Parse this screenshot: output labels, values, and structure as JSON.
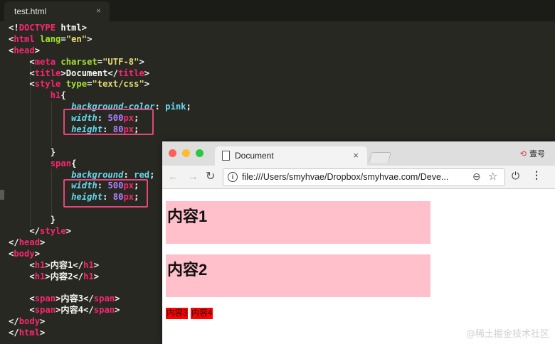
{
  "editor": {
    "tab_title": "test.html",
    "tab_close": "×",
    "code_lines": [
      [
        {
          "c": "pn",
          "t": "<!"
        },
        {
          "c": "tk",
          "t": "DOCTYPE"
        },
        {
          "c": "pn",
          "t": " html>"
        }
      ],
      [
        {
          "c": "pn",
          "t": "<"
        },
        {
          "c": "tk",
          "t": "html"
        },
        {
          "c": "at",
          "t": " lang"
        },
        {
          "c": "pn",
          "t": "="
        },
        {
          "c": "st",
          "t": "\"en\""
        },
        {
          "c": "pn",
          "t": ">"
        }
      ],
      [
        {
          "c": "pn",
          "t": "<"
        },
        {
          "c": "tk",
          "t": "head"
        },
        {
          "c": "pn",
          "t": ">"
        }
      ],
      [
        {
          "c": "pn",
          "t": "    <"
        },
        {
          "c": "tk",
          "t": "meta"
        },
        {
          "c": "at",
          "t": " charset"
        },
        {
          "c": "pn",
          "t": "="
        },
        {
          "c": "st",
          "t": "\"UTF-8\""
        },
        {
          "c": "pn",
          "t": ">"
        }
      ],
      [
        {
          "c": "pn",
          "t": "    <"
        },
        {
          "c": "tk",
          "t": "title"
        },
        {
          "c": "pn",
          "t": ">Document</"
        },
        {
          "c": "tk",
          "t": "title"
        },
        {
          "c": "pn",
          "t": ">"
        }
      ],
      [
        {
          "c": "pn",
          "t": "    <"
        },
        {
          "c": "tk",
          "t": "style"
        },
        {
          "c": "at",
          "t": " type"
        },
        {
          "c": "pn",
          "t": "="
        },
        {
          "c": "st",
          "t": "\"text/css\""
        },
        {
          "c": "pn",
          "t": ">"
        }
      ],
      [
        {
          "c": "pn",
          "t": "        "
        },
        {
          "c": "tk",
          "t": "h1"
        },
        {
          "c": "pn",
          "t": "{"
        }
      ],
      [
        {
          "c": "pn",
          "t": "            "
        },
        {
          "c": "pr",
          "t": "background-color"
        },
        {
          "c": "pn",
          "t": ": "
        },
        {
          "c": "kw",
          "t": "pink"
        },
        {
          "c": "pn",
          "t": ";"
        }
      ],
      [
        {
          "c": "pn",
          "t": "            "
        },
        {
          "c": "pr",
          "t": "width"
        },
        {
          "c": "pn",
          "t": ": "
        },
        {
          "c": "nm",
          "t": "500"
        },
        {
          "c": "un",
          "t": "px"
        },
        {
          "c": "pn",
          "t": ";"
        }
      ],
      [
        {
          "c": "pn",
          "t": "            "
        },
        {
          "c": "pr",
          "t": "height"
        },
        {
          "c": "pn",
          "t": ": "
        },
        {
          "c": "nm",
          "t": "80"
        },
        {
          "c": "un",
          "t": "px"
        },
        {
          "c": "pn",
          "t": ";"
        }
      ],
      [
        {
          "c": "pn",
          "t": ""
        }
      ],
      [
        {
          "c": "pn",
          "t": "        }"
        }
      ],
      [
        {
          "c": "pn",
          "t": "        "
        },
        {
          "c": "tk",
          "t": "span"
        },
        {
          "c": "pn",
          "t": "{"
        }
      ],
      [
        {
          "c": "pn",
          "t": "            "
        },
        {
          "c": "pr",
          "t": "background"
        },
        {
          "c": "pn",
          "t": ": "
        },
        {
          "c": "kw",
          "t": "red"
        },
        {
          "c": "pn",
          "t": ";"
        }
      ],
      [
        {
          "c": "pn",
          "t": "            "
        },
        {
          "c": "pr",
          "t": "width"
        },
        {
          "c": "pn",
          "t": ": "
        },
        {
          "c": "nm",
          "t": "500"
        },
        {
          "c": "un",
          "t": "px"
        },
        {
          "c": "pn",
          "t": ";"
        }
      ],
      [
        {
          "c": "pn",
          "t": "            "
        },
        {
          "c": "pr",
          "t": "height"
        },
        {
          "c": "pn",
          "t": ": "
        },
        {
          "c": "nm",
          "t": "80"
        },
        {
          "c": "un",
          "t": "px"
        },
        {
          "c": "pn",
          "t": ";"
        }
      ],
      [
        {
          "c": "pn",
          "t": ""
        }
      ],
      [
        {
          "c": "pn",
          "t": "        }"
        }
      ],
      [
        {
          "c": "pn",
          "t": "    </"
        },
        {
          "c": "tk",
          "t": "style"
        },
        {
          "c": "pn",
          "t": ">"
        }
      ],
      [
        {
          "c": "pn",
          "t": "</"
        },
        {
          "c": "tk",
          "t": "head"
        },
        {
          "c": "pn",
          "t": ">"
        }
      ],
      [
        {
          "c": "pn",
          "t": "<"
        },
        {
          "c": "tk",
          "t": "body"
        },
        {
          "c": "pn",
          "t": ">"
        }
      ],
      [
        {
          "c": "pn",
          "t": "    <"
        },
        {
          "c": "tk",
          "t": "h1"
        },
        {
          "c": "pn",
          "t": ">内容1</"
        },
        {
          "c": "tk",
          "t": "h1"
        },
        {
          "c": "pn",
          "t": ">"
        }
      ],
      [
        {
          "c": "pn",
          "t": "    <"
        },
        {
          "c": "tk",
          "t": "h1"
        },
        {
          "c": "pn",
          "t": ">内容2</"
        },
        {
          "c": "tk",
          "t": "h1"
        },
        {
          "c": "pn",
          "t": ">"
        }
      ],
      [
        {
          "c": "pn",
          "t": ""
        }
      ],
      [
        {
          "c": "pn",
          "t": "    <"
        },
        {
          "c": "tk",
          "t": "span"
        },
        {
          "c": "pn",
          "t": ">内容3</"
        },
        {
          "c": "tk",
          "t": "span"
        },
        {
          "c": "pn",
          "t": ">"
        }
      ],
      [
        {
          "c": "pn",
          "t": "    <"
        },
        {
          "c": "tk",
          "t": "span"
        },
        {
          "c": "pn",
          "t": ">内容4</"
        },
        {
          "c": "tk",
          "t": "span"
        },
        {
          "c": "pn",
          "t": ">"
        }
      ],
      [
        {
          "c": "pn",
          "t": "</"
        },
        {
          "c": "tk",
          "t": "body"
        },
        {
          "c": "pn",
          "t": ">"
        }
      ],
      [
        {
          "c": "pn",
          "t": "</"
        },
        {
          "c": "tk",
          "t": "html"
        },
        {
          "c": "pn",
          "t": ">"
        }
      ]
    ]
  },
  "browser": {
    "tab_title": "Document",
    "tab_close": "×",
    "profile_label": "壹号",
    "url": "file:///Users/smyhvae/Dropbox/smyhvae.com/Deve...",
    "page": {
      "h1_first": "内容1",
      "h1_second": "内容2",
      "span_first": "内容3",
      "span_second": "内容4"
    }
  },
  "watermark": "@稀土掘金技术社区",
  "colors": {
    "editor_bg": "#272822",
    "highlight_border": "#e0477a",
    "h1_bg": "#ffc0cb",
    "span_bg": "#ff0000"
  },
  "icons": [
    "close-icon",
    "document-icon",
    "info-icon",
    "zoom-icon",
    "star-icon",
    "power-icon",
    "menu-icon",
    "back-arrow-icon",
    "forward-arrow-icon",
    "reload-icon",
    "profile-icon"
  ]
}
